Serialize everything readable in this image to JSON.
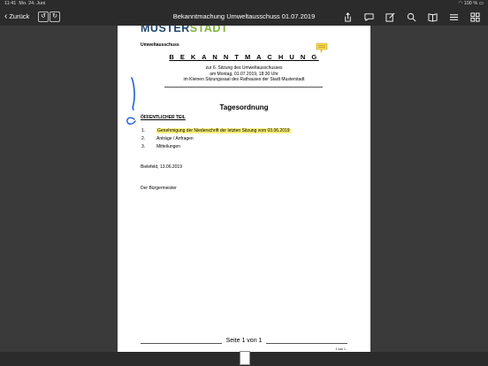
{
  "status_bar": {
    "time": "11:41",
    "date": "Mo. 24. Juni",
    "battery": "100 %"
  },
  "nav": {
    "back_label": "Zurück",
    "undo_icon": "undo-icon",
    "redo_icon": "redo-icon",
    "title": "Bekanntmachung Umweltausschuss 01.07.2019",
    "tools": [
      "share-icon",
      "comment-icon",
      "edit-icon",
      "search-icon",
      "book-icon",
      "list-icon",
      "grid-icon"
    ]
  },
  "document": {
    "logo": "MUSTERSTADT",
    "logo_primary": "MUSTER",
    "logo_accent": "STADT",
    "sender": "Umweltausschuss",
    "heading": "B E K A N N T M A C H U N G",
    "intro_lines": [
      "zur 6. Sitzung des Umweltausschusses",
      "am Montag, 01.07.2019, 18:30 Uhr",
      "im Kleinen Sitzungssaal des Rathauses der Stadt Musterstadt"
    ],
    "agenda_title": "Tagesordnung",
    "section_title": "ÖFFENTLICHER TEIL",
    "items": [
      {
        "num": "1.",
        "text": "Genehmigung der Niederschrift der letzten Sitzung vom 03.06.2019"
      },
      {
        "num": "2.",
        "text": "Anträge / Anfragen"
      },
      {
        "num": "3.",
        "text": "Mitteilungen"
      }
    ],
    "dateline": "Bielefeld, 13.06.2019",
    "signature": "Der Bürgermeister",
    "footer": "Seite 1 von 1",
    "page_label": "1 von 1"
  },
  "colors": {
    "logo_primary": "#24476b",
    "logo_accent": "#7fb33a",
    "highlight": "#fbf07a",
    "ink": "#1f5fd6"
  }
}
